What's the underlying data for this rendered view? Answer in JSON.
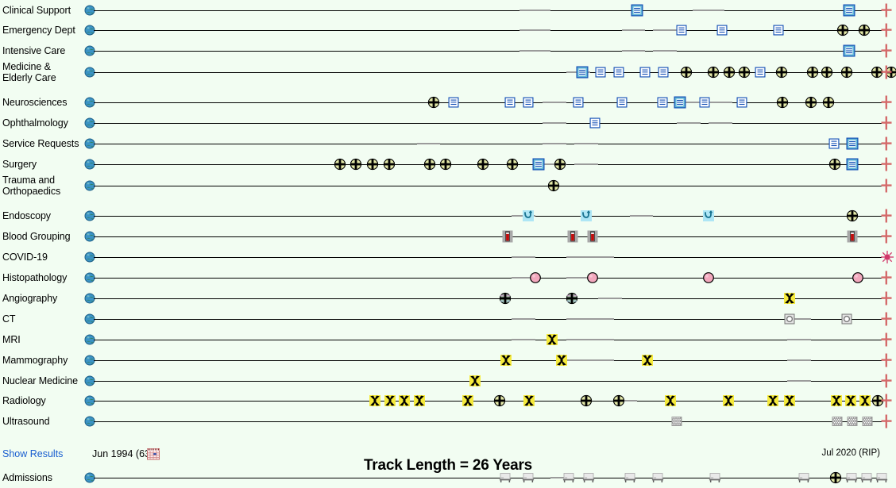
{
  "meta": {
    "bg_color": "#f2fdf2",
    "track_color": "#000000",
    "gap_color": "#9b9b9b",
    "link_color": "#1a5fd0",
    "end_marker_color": "#d46a6a"
  },
  "footer": {
    "show_results_label": "Show Results",
    "start_date_label": "Jun 1994 (63)",
    "end_date_label": "Jul 2020 (RIP)",
    "track_length_label": "Track Length = 26 Years",
    "calendar_icon": "calendar-icon"
  },
  "rows": [
    {
      "label": "Clinical Support",
      "icon": "globe-icon",
      "end_icon": "red-cross-icon",
      "gaps": [
        [
          54,
          4
        ],
        [
          76,
          4
        ]
      ],
      "markers": [
        {
          "type": "doc-blue-fill",
          "x": 69.0
        },
        {
          "type": "doc-blue-fill",
          "x": 95.9
        }
      ]
    },
    {
      "label": "Emergency Dept",
      "icon": "globe-icon",
      "end_icon": "red-cross-icon",
      "gaps": [
        [
          54,
          4
        ],
        [
          67,
          3
        ],
        [
          71,
          3
        ]
      ],
      "markers": [
        {
          "type": "doc-blue",
          "x": 74.6
        },
        {
          "type": "doc-blue",
          "x": 79.7
        },
        {
          "type": "doc-blue",
          "x": 86.9
        },
        {
          "type": "hospital-circle",
          "x": 95.1
        },
        {
          "type": "hospital-circle",
          "x": 97.8
        }
      ]
    },
    {
      "label": "Intensive Care",
      "icon": "globe-icon",
      "end_icon": "red-cross-icon",
      "gaps": [
        [
          54,
          4
        ],
        [
          67,
          3
        ],
        [
          71,
          3
        ]
      ],
      "markers": [
        {
          "type": "doc-blue-fill",
          "x": 95.9
        }
      ]
    },
    {
      "label": "Medicine & Elderly Care",
      "icon": "globe-icon",
      "end_icon": "red-cross-icon",
      "two_line": true,
      "gaps": [
        [
          60,
          3
        ]
      ],
      "markers": [
        {
          "type": "doc-blue-fill",
          "x": 62.0
        },
        {
          "type": "doc-blue",
          "x": 64.3
        },
        {
          "type": "doc-blue",
          "x": 66.6
        },
        {
          "type": "doc-blue",
          "x": 70.0
        },
        {
          "type": "doc-blue",
          "x": 72.3
        },
        {
          "type": "hospital-circle",
          "x": 75.2
        },
        {
          "type": "hospital-circle",
          "x": 78.6
        },
        {
          "type": "hospital-circle",
          "x": 80.6
        },
        {
          "type": "hospital-circle",
          "x": 82.6
        },
        {
          "type": "doc-blue",
          "x": 84.6
        },
        {
          "type": "hospital-circle",
          "x": 87.3
        },
        {
          "type": "hospital-circle",
          "x": 91.2
        },
        {
          "type": "hospital-circle",
          "x": 93.0
        },
        {
          "type": "hospital-circle",
          "x": 95.6
        },
        {
          "type": "hospital-circle",
          "x": 99.4
        },
        {
          "type": "hospital-circle",
          "x": 101.2
        },
        {
          "type": "hospital-circle",
          "x": 103.0
        },
        {
          "type": "hospital-circle",
          "x": 104.7
        },
        {
          "type": "hospital-circle-green",
          "x": 106.2
        },
        {
          "type": "hospital-circle",
          "x": 108.0
        },
        {
          "type": "doc-blue",
          "x": 110.0
        }
      ]
    },
    {
      "label": "Neurosciences",
      "icon": "globe-icon",
      "end_icon": "red-cross-icon",
      "gaps": [
        [
          57,
          3
        ],
        [
          74,
          3
        ],
        [
          78,
          3
        ]
      ],
      "markers": [
        {
          "type": "hospital-circle",
          "x": 43.1
        },
        {
          "type": "doc-blue",
          "x": 45.7
        },
        {
          "type": "doc-blue",
          "x": 52.8
        },
        {
          "type": "doc-blue",
          "x": 55.1
        },
        {
          "type": "doc-blue",
          "x": 61.5
        },
        {
          "type": "doc-blue",
          "x": 67.0
        },
        {
          "type": "doc-blue",
          "x": 72.2
        },
        {
          "type": "doc-blue-fill",
          "x": 74.4
        },
        {
          "type": "doc-blue",
          "x": 77.5
        },
        {
          "type": "doc-blue",
          "x": 82.3
        },
        {
          "type": "hospital-circle",
          "x": 87.4
        },
        {
          "type": "hospital-circle",
          "x": 91.0
        },
        {
          "type": "hospital-circle",
          "x": 93.2
        }
      ]
    },
    {
      "label": "Ophthalmology",
      "icon": "globe-icon",
      "end_icon": "red-cross-icon",
      "gaps": [
        [
          57,
          3
        ],
        [
          74,
          3
        ],
        [
          78,
          3
        ]
      ],
      "markers": [
        {
          "type": "doc-blue",
          "x": 63.6
        }
      ]
    },
    {
      "label": "Service Requests",
      "icon": "globe-icon",
      "end_icon": "red-cross-icon",
      "gaps": [
        [
          41,
          3
        ],
        [
          57,
          3
        ],
        [
          61,
          3
        ]
      ],
      "markers": [
        {
          "type": "doc-blue",
          "x": 94.0
        },
        {
          "type": "doc-blue-fill",
          "x": 96.3
        }
      ]
    },
    {
      "label": "Surgery",
      "icon": "globe-icon",
      "end_icon": "red-cross-icon",
      "gaps": [
        [
          57,
          3
        ],
        [
          61,
          3
        ]
      ],
      "markers": [
        {
          "type": "hospital-circle",
          "x": 31.2
        },
        {
          "type": "hospital-circle",
          "x": 33.3
        },
        {
          "type": "hospital-circle",
          "x": 35.4
        },
        {
          "type": "hospital-circle",
          "x": 37.5
        },
        {
          "type": "hospital-circle",
          "x": 42.6
        },
        {
          "type": "hospital-circle",
          "x": 44.7
        },
        {
          "type": "hospital-circle",
          "x": 49.4
        },
        {
          "type": "hospital-circle",
          "x": 53.1
        },
        {
          "type": "doc-blue-fill",
          "x": 56.5
        },
        {
          "type": "hospital-circle",
          "x": 59.2
        },
        {
          "type": "hospital-circle",
          "x": 94.1
        },
        {
          "type": "doc-blue-fill",
          "x": 96.3
        }
      ]
    },
    {
      "label": "Trauma and Orthopaedics",
      "icon": "globe-icon",
      "end_icon": "red-cross-icon",
      "two_line": true,
      "gaps": [],
      "markers": [
        {
          "type": "hospital-circle",
          "x": 58.4
        }
      ]
    },
    {
      "label": "Endoscopy",
      "icon": "globe-icon",
      "end_icon": "red-cross-icon",
      "gaps": [
        [
          53,
          3
        ],
        [
          68,
          3
        ]
      ],
      "markers": [
        {
          "type": "endoscope",
          "x": 55.1
        },
        {
          "type": "endoscope",
          "x": 62.5
        },
        {
          "type": "endoscope",
          "x": 78.0
        },
        {
          "type": "hospital-circle",
          "x": 96.3
        }
      ]
    },
    {
      "label": "Blood Grouping",
      "icon": "globe-icon",
      "end_icon": "red-cross-icon",
      "gaps": [],
      "markers": [
        {
          "type": "blood-vial",
          "x": 52.5
        },
        {
          "type": "blood-vial",
          "x": 60.8
        },
        {
          "type": "blood-vial",
          "x": 63.3
        },
        {
          "type": "blood-vial",
          "x": 96.3
        }
      ]
    },
    {
      "label": "COVID-19",
      "icon": "globe-icon",
      "end_icon": "virus-icon",
      "gaps": [
        [
          53,
          3
        ],
        [
          60,
          3
        ],
        [
          63,
          3
        ]
      ],
      "markers": []
    },
    {
      "label": "Histopathology",
      "icon": "globe-icon",
      "end_icon": "red-cross-icon",
      "gaps": [
        [
          53,
          3
        ],
        [
          60,
          3
        ]
      ],
      "markers": [
        {
          "type": "pink-circle",
          "x": 56.0
        },
        {
          "type": "pink-circle",
          "x": 63.3
        },
        {
          "type": "pink-circle",
          "x": 78.0
        },
        {
          "type": "pink-circle",
          "x": 97.0
        }
      ]
    },
    {
      "label": "Angiography",
      "icon": "globe-icon",
      "end_icon": "red-cross-icon",
      "gaps": [
        [
          64,
          3
        ]
      ],
      "markers": [
        {
          "type": "angio-circle",
          "x": 52.2
        },
        {
          "type": "angio-circle",
          "x": 60.7
        },
        {
          "type": "radiation",
          "x": 88.3
        }
      ]
    },
    {
      "label": "CT",
      "icon": "globe-icon",
      "end_icon": "red-cross-icon",
      "gaps": [
        [
          53,
          3
        ],
        [
          60,
          3
        ],
        [
          63,
          3
        ],
        [
          88,
          3
        ]
      ],
      "markers": [
        {
          "type": "ct-square",
          "x": 88.3
        },
        {
          "type": "ct-square",
          "x": 95.6
        }
      ]
    },
    {
      "label": "MRI",
      "icon": "globe-icon",
      "end_icon": "red-cross-icon",
      "gaps": [
        [
          53,
          3
        ],
        [
          60,
          3
        ],
        [
          63,
          3
        ],
        [
          88,
          3
        ]
      ],
      "markers": [
        {
          "type": "radiation",
          "x": 58.2
        }
      ]
    },
    {
      "label": "Mammography",
      "icon": "globe-icon",
      "end_icon": "red-cross-icon",
      "gaps": [
        [
          60,
          3
        ],
        [
          63,
          3
        ],
        [
          88,
          3
        ]
      ],
      "markers": [
        {
          "type": "radiation",
          "x": 52.3
        },
        {
          "type": "radiation",
          "x": 59.4
        },
        {
          "type": "radiation",
          "x": 70.3
        }
      ]
    },
    {
      "label": "Nuclear Medicine",
      "icon": "globe-icon",
      "end_icon": "red-cross-icon",
      "gaps": [
        [
          88,
          3
        ]
      ],
      "markers": [
        {
          "type": "radiation",
          "x": 48.4
        }
      ]
    },
    {
      "label": "Radiology",
      "icon": "globe-icon",
      "end_icon": "red-cross-icon",
      "gaps": [
        [
          66,
          3
        ]
      ],
      "markers": [
        {
          "type": "radiation",
          "x": 35.7
        },
        {
          "type": "radiation",
          "x": 37.6
        },
        {
          "type": "radiation",
          "x": 39.4
        },
        {
          "type": "radiation",
          "x": 41.3
        },
        {
          "type": "radiation",
          "x": 47.5
        },
        {
          "type": "hospital-circle",
          "x": 51.5
        },
        {
          "type": "radiation",
          "x": 55.2
        },
        {
          "type": "hospital-circle",
          "x": 62.5
        },
        {
          "type": "hospital-circle",
          "x": 66.6
        },
        {
          "type": "radiation",
          "x": 73.2
        },
        {
          "type": "radiation",
          "x": 80.5
        },
        {
          "type": "radiation",
          "x": 86.2
        },
        {
          "type": "radiation",
          "x": 88.3
        },
        {
          "type": "radiation",
          "x": 94.3
        },
        {
          "type": "radiation",
          "x": 96.1
        },
        {
          "type": "radiation",
          "x": 97.9
        },
        {
          "type": "hospital-circle",
          "x": 99.5
        }
      ]
    },
    {
      "label": "Ultrasound",
      "icon": "globe-icon",
      "end_icon": "red-cross-icon",
      "gaps": [],
      "markers": [
        {
          "type": "us-square",
          "x": 74.0
        },
        {
          "type": "us-square",
          "x": 94.4
        },
        {
          "type": "us-square",
          "x": 96.3
        },
        {
          "type": "us-square",
          "x": 98.2
        }
      ]
    }
  ],
  "admissions_row": {
    "label": "Admissions",
    "icon": "globe-icon",
    "gaps": [
      [
        58,
        3
      ]
    ],
    "markers": [
      {
        "type": "bed",
        "x": 52.2
      },
      {
        "type": "bed",
        "x": 55.1
      },
      {
        "type": "bed",
        "x": 60.3
      },
      {
        "type": "bed",
        "x": 62.8
      },
      {
        "type": "bed",
        "x": 68.0
      },
      {
        "type": "bed",
        "x": 71.6
      },
      {
        "type": "bed",
        "x": 78.8
      },
      {
        "type": "bed",
        "x": 90.1
      },
      {
        "type": "hospital-circle",
        "x": 94.2
      },
      {
        "type": "bed",
        "x": 96.2
      },
      {
        "type": "bed",
        "x": 98.1
      },
      {
        "type": "bed",
        "x": 100.0
      }
    ]
  }
}
